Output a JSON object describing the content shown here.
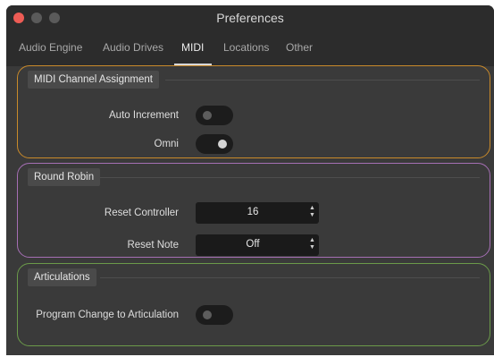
{
  "window": {
    "title": "Preferences"
  },
  "tabs": [
    {
      "label": "Audio Engine"
    },
    {
      "label": "Audio Drives"
    },
    {
      "label": "MIDI",
      "active": true
    },
    {
      "label": "Locations"
    },
    {
      "label": "Other"
    }
  ],
  "sections": {
    "midi_channel": {
      "title": "MIDI Channel Assignment",
      "auto_increment": {
        "label": "Auto Increment",
        "on": false
      },
      "omni": {
        "label": "Omni",
        "on": true
      }
    },
    "round_robin": {
      "title": "Round Robin",
      "reset_controller": {
        "label": "Reset Controller",
        "value": "16"
      },
      "reset_note": {
        "label": "Reset Note",
        "value": "Off"
      }
    },
    "articulations": {
      "title": "Articulations",
      "program_change": {
        "label": "Program Change to Articulation",
        "on": false
      }
    }
  },
  "colors": {
    "close_button": "#ed5c55",
    "midi_section_border": "#c98a2a",
    "round_robin_section_border": "#a56fb4",
    "articulations_section_border": "#6b9a4a"
  }
}
